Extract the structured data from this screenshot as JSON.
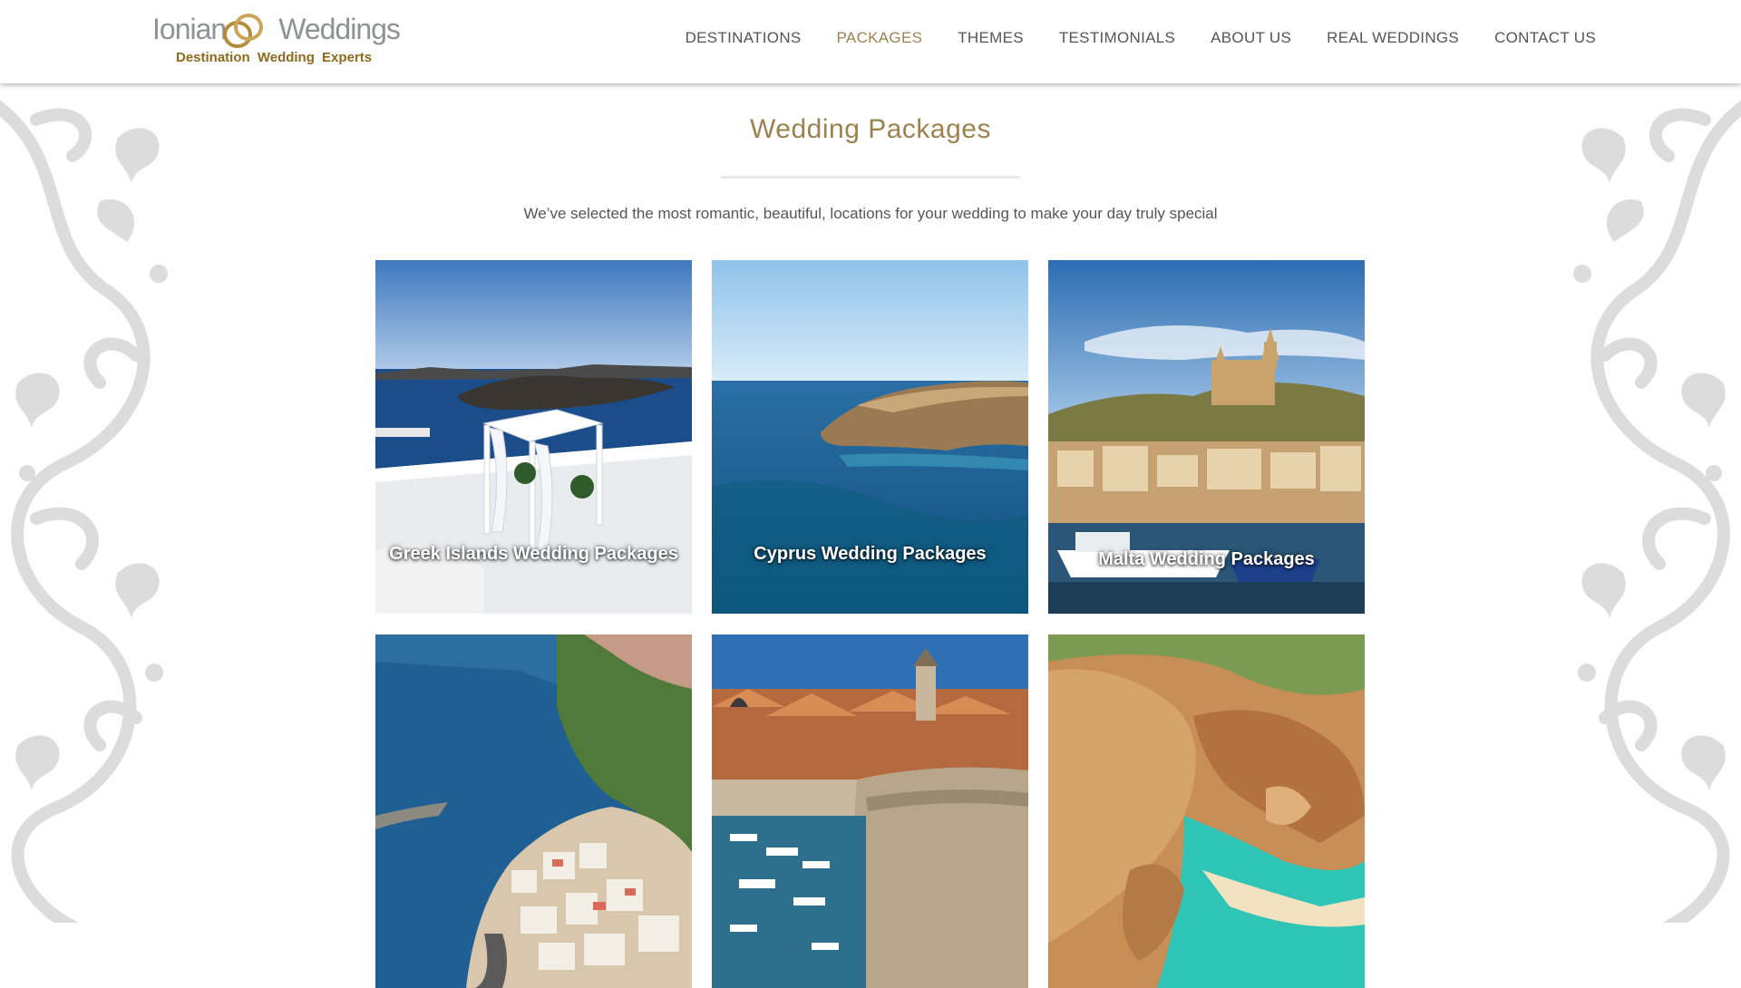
{
  "logo": {
    "name_part1": "Ionian",
    "name_part2": "Weddings",
    "tagline": "Destination Wedding Experts"
  },
  "nav": {
    "items": [
      {
        "label": "DESTINATIONS",
        "active": false
      },
      {
        "label": "PACKAGES",
        "active": true
      },
      {
        "label": "THEMES",
        "active": false
      },
      {
        "label": "TESTIMONIALS",
        "active": false
      },
      {
        "label": "ABOUT US",
        "active": false
      },
      {
        "label": "REAL WEDDINGS",
        "active": false
      },
      {
        "label": "CONTACT US",
        "active": false
      }
    ]
  },
  "page": {
    "title": "Wedding Packages",
    "subtitle": "We’ve selected the most romantic, beautiful, locations for your wedding to make your day truly special"
  },
  "packages": [
    {
      "label": "Greek Islands Wedding Packages",
      "image": "santorini-gazebo"
    },
    {
      "label": "Cyprus Wedding Packages",
      "image": "cyprus-coast"
    },
    {
      "label": "Malta Wedding Packages",
      "image": "malta-harbour"
    },
    {
      "label": "",
      "image": "amalfi-coast"
    },
    {
      "label": "",
      "image": "dubrovnik-harbour"
    },
    {
      "label": "",
      "image": "algarve-cliffs"
    }
  ],
  "colors": {
    "accent": "#9b8350",
    "nav_text": "#555555",
    "flourish": "#dcdcdc"
  }
}
